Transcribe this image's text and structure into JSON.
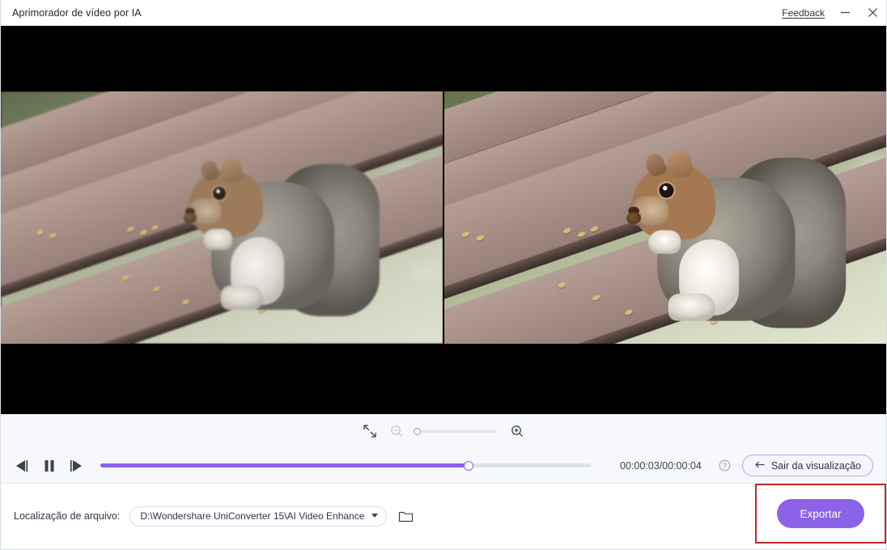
{
  "window": {
    "title": "Aprimorador de vídeo por IA",
    "feedback_label": "Feedback",
    "minimize_icon": "minimize-icon",
    "close_icon": "close-icon"
  },
  "preview": {
    "left_pane_name": "original-preview",
    "right_pane_name": "enhanced-preview",
    "scene_description": "squirrel on wooden bench"
  },
  "zoom_controls": {
    "fit_icon": "fit-to-screen-icon",
    "zoom_out_icon": "zoom-out-icon",
    "zoom_in_icon": "zoom-in-icon",
    "slider_position_percent": 0
  },
  "transport": {
    "previous_frame_icon": "previous-frame-icon",
    "pause_icon": "pause-icon",
    "next_frame_icon": "next-frame-icon",
    "progress_percent": 75,
    "timecode": "00:00:03/00:00:04",
    "help_icon": "help-circle-icon",
    "exit_preview_label": "Sair da visualização",
    "exit_preview_icon": "back-arrow-icon"
  },
  "bottom": {
    "location_label": "Localização de arquivo:",
    "location_value": "D:\\Wondershare UniConverter 15\\AI Video Enhance",
    "folder_icon": "folder-icon",
    "export_label": "Exportar"
  },
  "colors": {
    "accent": "#8c62e8",
    "highlight": "#c0282d",
    "panel": "#f6f8fb"
  }
}
